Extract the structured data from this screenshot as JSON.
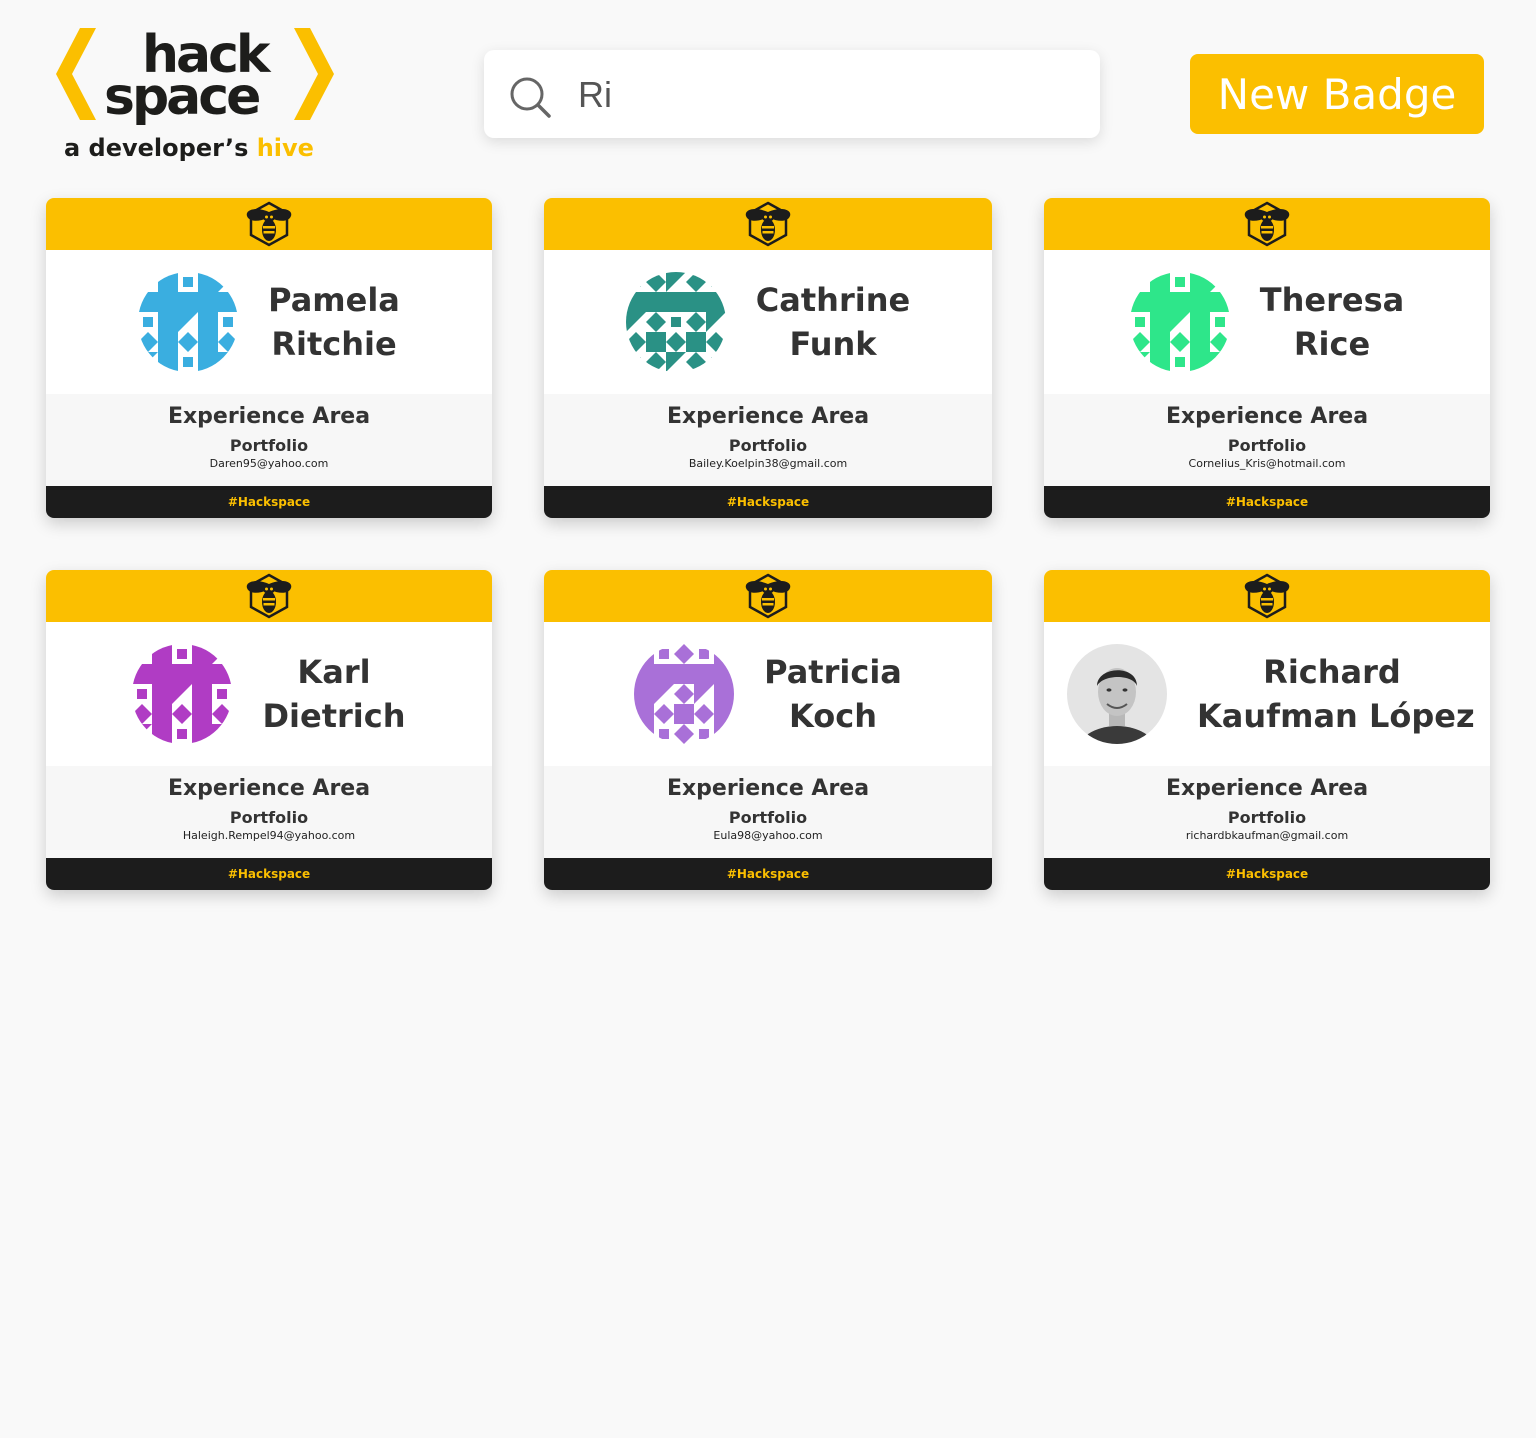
{
  "logo": {
    "line1": "hack",
    "line2": "space",
    "tagline_start": "a developer’s",
    "tagline_end": "hive",
    "accent_color": "#fbbf00",
    "dark_color": "#1d1d1b"
  },
  "search": {
    "value": "Ri",
    "icon": "search-icon"
  },
  "header": {
    "new_badge_label": "New Badge"
  },
  "cards": [
    {
      "first": "Pamela",
      "last": "Ritchie",
      "experience": "Experience Area",
      "portfolio": "Portfolio",
      "email": "Daren95@yahoo.com",
      "tag": "#Hackspace",
      "avatar_color": "#3aaee0",
      "avatar_type": "identicon"
    },
    {
      "first": "Cathrine",
      "last": "Funk",
      "experience": "Experience Area",
      "portfolio": "Portfolio",
      "email": "Bailey.Koelpin38@gmail.com",
      "tag": "#Hackspace",
      "avatar_color": "#2a9185",
      "avatar_type": "identicon"
    },
    {
      "first": "Theresa",
      "last": "Rice",
      "experience": "Experience Area",
      "portfolio": "Portfolio",
      "email": "Cornelius_Kris@hotmail.com",
      "tag": "#Hackspace",
      "avatar_color": "#2ee68a",
      "avatar_type": "identicon"
    },
    {
      "first": "Karl",
      "last": "Dietrich",
      "experience": "Experience Area",
      "portfolio": "Portfolio",
      "email": "Haleigh.Rempel94@yahoo.com",
      "tag": "#Hackspace",
      "avatar_color": "#b03cc4",
      "avatar_type": "identicon"
    },
    {
      "first": "Patricia",
      "last": "Koch",
      "experience": "Experience Area",
      "portfolio": "Portfolio",
      "email": "Eula98@yahoo.com",
      "tag": "#Hackspace",
      "avatar_color": "#a970d8",
      "avatar_type": "identicon"
    },
    {
      "first": "Richard",
      "last": "Kaufman López",
      "experience": "Experience Area",
      "portfolio": "Portfolio",
      "email": "richardbkaufman@gmail.com",
      "tag": "#Hackspace",
      "avatar_color": "#9a9a9a",
      "avatar_type": "photo"
    }
  ],
  "colors": {
    "accent": "#fbbf00",
    "dark": "#1c1c1c",
    "background": "#f9f9f9"
  }
}
